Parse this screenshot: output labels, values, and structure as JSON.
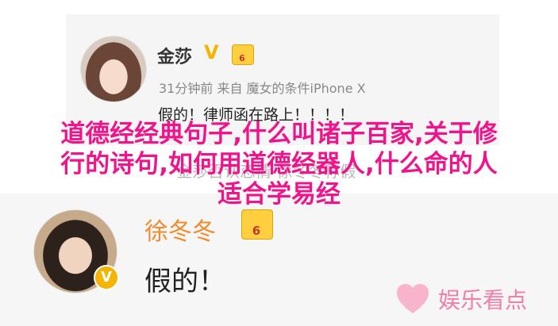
{
  "top_post": {
    "username": "金莎",
    "verify_mark": "V",
    "level": "6",
    "meta": "31分钟前 来自 魔女的条件iPhone X",
    "text": "假的！律师函在路上！！！！"
  },
  "caption_faint": "金莎否认恋情 徐冬冬称假",
  "overlay": {
    "line1": "道德经经典句子,什么叫诸子百家,关于修",
    "line2": "行的诗句,如何用道德经器人,什么命的人",
    "line3": "适合学易经"
  },
  "bottom_post": {
    "username": "徐冬冬",
    "level": "6",
    "badge": "V",
    "text": "假的！"
  },
  "watermark": {
    "text": "娱乐看点"
  },
  "colors": {
    "overlay": "#f0148c",
    "username_orange": "#f08c2e",
    "gold": "#f4b400",
    "watermark": "#f27ea8"
  }
}
